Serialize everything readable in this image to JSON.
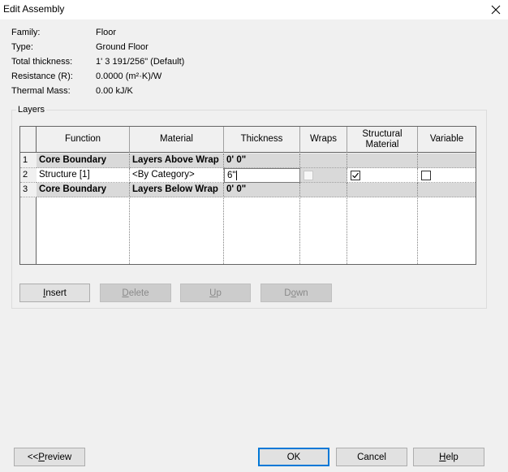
{
  "window": {
    "title": "Edit Assembly"
  },
  "info": [
    {
      "label": "Family:",
      "value": "Floor"
    },
    {
      "label": "Type:",
      "value": "Ground Floor"
    },
    {
      "label": "Total thickness:",
      "value": "1'  3 191/256\" (Default)"
    },
    {
      "label": "Resistance (R):",
      "value": "0.0000 (m²·K)/W"
    },
    {
      "label": "Thermal Mass:",
      "value": "0.00 kJ/K"
    }
  ],
  "layers": {
    "legend": "Layers",
    "columns": [
      "Function",
      "Material",
      "Thickness",
      "Wraps",
      "Structural\nMaterial",
      "Variable"
    ],
    "rows": [
      {
        "num": "1",
        "function": "Core Boundary",
        "material": "Layers Above Wrap",
        "thickness": "0'  0\"",
        "shaded": true
      },
      {
        "num": "2",
        "function": "Structure [1]",
        "material": "<By Category>",
        "thickness": "6\"",
        "shaded": false,
        "wraps": false,
        "structural": true,
        "variable": false
      },
      {
        "num": "3",
        "function": "Core Boundary",
        "material": "Layers Below Wrap",
        "thickness": "0'  0\"",
        "shaded": true
      }
    ],
    "buttons": {
      "insert": {
        "pre": "",
        "u": "I",
        "post": "nsert"
      },
      "delete": {
        "pre": "",
        "u": "D",
        "post": "elete"
      },
      "up": {
        "pre": "",
        "u": "U",
        "post": "p"
      },
      "down": {
        "pre": "D",
        "u": "o",
        "post": "wn"
      }
    }
  },
  "footer": {
    "preview": {
      "pre": "<< ",
      "u": "P",
      "post": "review"
    },
    "ok": "OK",
    "cancel": "Cancel",
    "help": {
      "pre": "",
      "u": "H",
      "post": "elp"
    }
  }
}
